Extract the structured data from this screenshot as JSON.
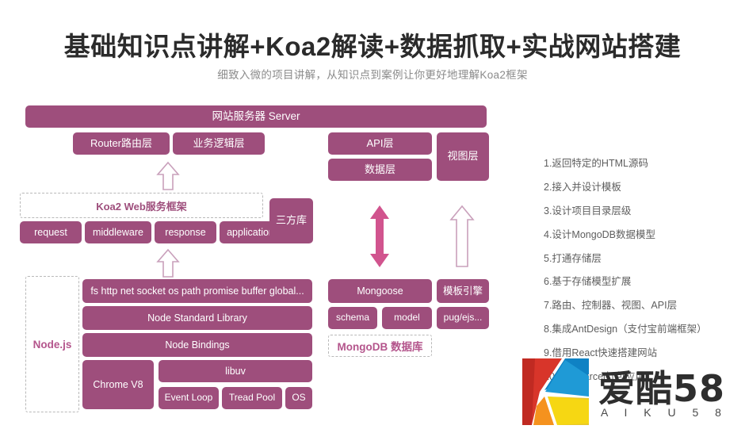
{
  "header": {
    "title": "基础知识点讲解+Koa2解读+数据抓取+实战网站搭建",
    "subtitle": "细致入微的项目讲解，从知识点到案例让你更好地理解Koa2框架"
  },
  "colors": {
    "box_purple": "#9e4e7c",
    "arrow_pink": "#d1548e",
    "arrow_outline": "#c9a0bb",
    "dashed_border": "#b9b9b9",
    "accent_text": "#b4558c",
    "logo_red": "#d8352a",
    "logo_red_dark": "#c02a22",
    "logo_blue": "#1f9ad6",
    "logo_blue_dark": "#0f82c4",
    "logo_yellow": "#f6d713",
    "logo_yellow_dark": "#e8c82b",
    "logo_orange": "#f5921e"
  },
  "diagram": {
    "server_bar": "网站服务器 Server",
    "left_column": {
      "router_layer": "Router路由层",
      "business_layer": "业务逻辑层",
      "koa_framework": "Koa2 Web服务框架",
      "koa_parts": [
        "request",
        "middleware",
        "response",
        "application"
      ],
      "third_party": "三方库",
      "nodejs_label": "Node.js",
      "node_modules": "fs http net socket os path promise buffer global...",
      "node_standard_library": "Node Standard Library",
      "node_bindings": "Node Bindings",
      "chrome_v8": "Chrome V8",
      "libuv": "libuv",
      "event_loop": "Event Loop",
      "thread_pool": "Tread Pool",
      "os": "OS"
    },
    "right_column": {
      "api_layer": "API层",
      "data_layer": "数据层",
      "view_layer": "视图层",
      "mongoose": "Mongoose",
      "schema": "schema",
      "model": "model",
      "template_engine": "模板引擎",
      "pug_ejs": "pug/ejs...",
      "mongodb": "MongoDB 数据库"
    },
    "arrows": {
      "up_arrow_left_top": "up-arrow-outline",
      "up_arrow_left_bottom": "up-arrow-outline",
      "double_arrow_middle": "up-down-arrow-filled",
      "up_arrow_right": "up-arrow-outline-tall"
    }
  },
  "features": [
    "1.返回特定的HTML源码",
    "2.接入并设计模板",
    "3.设计项目目录层级",
    "4.设计MongoDB数据模型",
    "5.打通存储层",
    "6.基于存储模型扩展",
    "7.路由、控制器、视图、API层",
    "8.集成AntDesign（支付宝前端框架）",
    "9.借用React快速搭建网站",
    "10.通过Parcel打包应用"
  ],
  "logo": {
    "name_cn": "爱酷58",
    "name_en": "A I K U 5 8",
    "mark": "k-logo-icon"
  }
}
